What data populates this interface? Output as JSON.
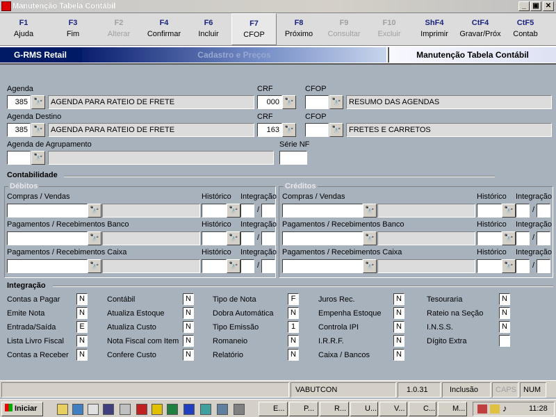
{
  "window": {
    "title": "Manutenção Tabela Contábil",
    "min": "_",
    "max": "▣",
    "close": "✕"
  },
  "toolbar": [
    {
      "key": "F1",
      "label": "Ajuda",
      "enabled": true
    },
    {
      "key": "F3",
      "label": "Fim",
      "enabled": true
    },
    {
      "key": "F2",
      "label": "Alterar",
      "enabled": false
    },
    {
      "key": "F4",
      "label": "Confirmar",
      "enabled": true
    },
    {
      "key": "F6",
      "label": "Incluir",
      "enabled": true
    },
    {
      "key": "F7",
      "label": "CFOP",
      "enabled": true
    },
    {
      "key": "F8",
      "label": "Próximo",
      "enabled": true
    },
    {
      "key": "F9",
      "label": "Consultar",
      "enabled": false
    },
    {
      "key": "F10",
      "label": "Excluir",
      "enabled": false
    },
    {
      "key": "ShF4",
      "label": "Imprimir",
      "enabled": true
    },
    {
      "key": "CtF4",
      "label": "Gravar/Próx",
      "enabled": true
    },
    {
      "key": "CtF5",
      "label": "Contab",
      "enabled": true
    }
  ],
  "header": {
    "brand": "G-RMS Retail",
    "module": "Cadastro e Preços",
    "screen": "Manutenção Tabela Contábil"
  },
  "form": {
    "agenda": {
      "label": "Agenda",
      "code": "385",
      "desc": "AGENDA PARA RATEIO DE FRETE"
    },
    "crf1": {
      "label": "CRF",
      "value": "000"
    },
    "cfop1": {
      "label": "CFOP",
      "value": "",
      "desc": "RESUMO DAS AGENDAS"
    },
    "agenda_destino": {
      "label": "Agenda Destino",
      "code": "385",
      "desc": "AGENDA PARA RATEIO DE FRETE"
    },
    "crf2": {
      "label": "CRF",
      "value": "163"
    },
    "cfop2": {
      "label": "CFOP",
      "value": "",
      "desc": "FRETES E CARRETOS"
    },
    "agrupamento": {
      "label": "Agenda de Agrupamento",
      "code": "",
      "desc": ""
    },
    "serie_nf": {
      "label": "Série NF",
      "value": ""
    }
  },
  "contabilidade": {
    "title": "Contabilidade",
    "debitos": {
      "title": "Débitos",
      "rows": [
        {
          "label": "Compras / Vendas",
          "historico": "Histórico",
          "integracao": "Integração",
          "sep": "/"
        },
        {
          "label": "Pagamentos / Recebimentos Banco",
          "historico": "Histórico",
          "integracao": "Integração",
          "sep": "/"
        },
        {
          "label": "Pagamentos / Recebimentos Caixa",
          "historico": "Histórico",
          "integracao": "Integração",
          "sep": "/"
        }
      ]
    },
    "creditos": {
      "title": "Créditos",
      "rows": [
        {
          "label": "Compras / Vendas",
          "historico": "Histórico",
          "integracao": "Integração",
          "sep": "/"
        },
        {
          "label": "Pagamentos / Recebimentos Banco",
          "historico": "Histórico",
          "integracao": "Integração",
          "sep": "/"
        },
        {
          "label": "Pagamentos / Recebimentos Caixa",
          "historico": "Histórico",
          "integracao": "Integração",
          "sep": "/"
        }
      ]
    }
  },
  "integracao": {
    "title": "Integração",
    "columns": [
      [
        {
          "label": "Contas a Pagar",
          "value": "N"
        },
        {
          "label": "Emite Nota",
          "value": "N"
        },
        {
          "label": "Entrada/Saída",
          "value": "E"
        },
        {
          "label": "Lista Livro Fiscal",
          "value": "N"
        },
        {
          "label": "Contas a Receber",
          "value": "N"
        }
      ],
      [
        {
          "label": "Contábil",
          "value": "N"
        },
        {
          "label": "Atualiza Estoque",
          "value": "N"
        },
        {
          "label": "Atualiza Custo",
          "value": "N"
        },
        {
          "label": "Nota Fiscal com Item",
          "value": "N"
        },
        {
          "label": "Confere Custo",
          "value": "N"
        }
      ],
      [
        {
          "label": "Tipo de Nota",
          "value": "F"
        },
        {
          "label": "Dobra Automática",
          "value": "N"
        },
        {
          "label": "Tipo Emissão",
          "value": "1"
        },
        {
          "label": "Romaneio",
          "value": "N"
        },
        {
          "label": "Relatório",
          "value": "N"
        }
      ],
      [
        {
          "label": "Juros Rec.",
          "value": "N"
        },
        {
          "label": "Empenha Estoque",
          "value": "N"
        },
        {
          "label": "Controla IPI",
          "value": "N"
        },
        {
          "label": "I.R.R.F.",
          "value": "N"
        },
        {
          "label": "Caixa / Bancos",
          "value": "N"
        }
      ],
      [
        {
          "label": "Tesouraria",
          "value": "N"
        },
        {
          "label": "Rateio na Seção",
          "value": "N"
        },
        {
          "label": "I.N.S.S.",
          "value": "N"
        },
        {
          "label": "Dígito Extra",
          "value": ""
        }
      ]
    ]
  },
  "statusbar": {
    "user": "VABUTCON",
    "version": "1.0.31",
    "mode": "Inclusão",
    "caps": "CAPS",
    "num": "NUM"
  },
  "taskbar": {
    "start": "Iniciar",
    "tasks": [
      "E...",
      "P...",
      "R...",
      "U...",
      "V...",
      "C...",
      "M..."
    ],
    "clock": "11:28"
  },
  "icons": {
    "binoculars": "binoculars-icon"
  },
  "colors": {
    "accent": "#001a66",
    "background": "#a8b2bc"
  }
}
